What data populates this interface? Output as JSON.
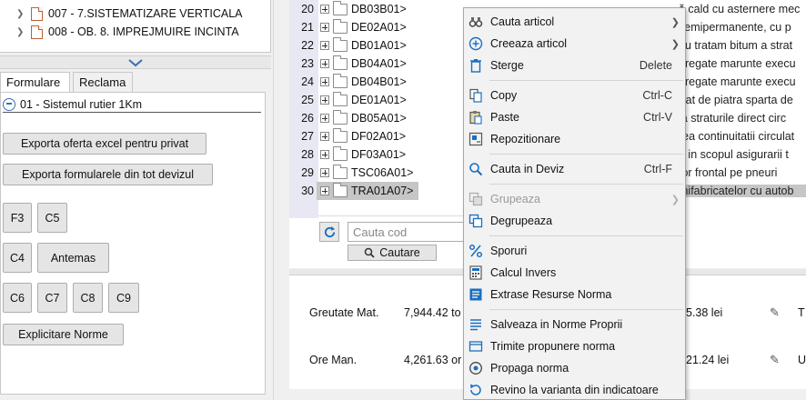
{
  "left_tree": {
    "items": [
      {
        "label": "007 - 7.SISTEMATIZARE VERTICALA"
      },
      {
        "label": "008 - OB. 8. IMPREJMUIRE INCINTA"
      }
    ]
  },
  "left_tabs": [
    {
      "label": "Formulare"
    },
    {
      "label": "Reclama"
    }
  ],
  "form_pane": {
    "title": "01 - Sistemul rutier 1Km",
    "buttons": {
      "export_excel": "Exporta oferta excel pentru privat",
      "export_forms": "Exporta formularele din tot devizul",
      "f3": "F3",
      "c5": "C5",
      "c4": "C4",
      "antemas": "Antemas",
      "c6": "C6",
      "c7": "C7",
      "c8": "C8",
      "c9": "C9",
      "explicitare": "Explicitare Norme"
    }
  },
  "grid": {
    "rows": [
      {
        "num": "20",
        "code": "DB03B01>",
        "desc": "ă cald cu asternere mec"
      },
      {
        "num": "21",
        "code": "DE02A01>",
        "desc": "semipermanente, cu p"
      },
      {
        "num": "22",
        "code": "DB01A01>",
        "desc": "au tratam bitum a strat"
      },
      {
        "num": "23",
        "code": "DB04A01>",
        "desc": "gregate marunte execu"
      },
      {
        "num": "24",
        "code": "DB04B01>",
        "desc": "gregate marunte execu"
      },
      {
        "num": "25",
        "code": "DE01A01>",
        "desc": "trat de piatra sparta de"
      },
      {
        "num": "26",
        "code": "DB05A01>",
        "desc": "la straturile direct circ"
      },
      {
        "num": "27",
        "code": "DF02A01>",
        "desc": "rea continuitatii circulat"
      },
      {
        "num": "28",
        "code": "DF03A01>",
        "desc": "e in scopul asigurarii t"
      },
      {
        "num": "29",
        "code": "TSC06A01>",
        "desc": "tor frontal pe pneuri"
      },
      {
        "num": "30",
        "code": "TRA01A07>",
        "desc": "mifabricatelor cu autob",
        "selected": true
      }
    ]
  },
  "search": {
    "placeholder": "Cauta cod",
    "button_label": "Cautare"
  },
  "bottom": {
    "rows": [
      {
        "label": "Greutate Mat.",
        "value": "7,944.42 to",
        "lei": "5.38 lei",
        "trail": "T"
      },
      {
        "label": "Ore Man.",
        "value": "4,261.63 or",
        "lei": "21.24 lei",
        "trail": "U"
      }
    ]
  },
  "context_menu": {
    "items": [
      {
        "label": "Cauta articol",
        "submenu": true,
        "icon": "binoculars-icon"
      },
      {
        "label": "Creeaza articol",
        "submenu": true,
        "icon": "plus-circle-icon"
      },
      {
        "label": "Sterge",
        "shortcut": "Delete",
        "icon": "trash-icon"
      },
      {
        "label": "Copy",
        "shortcut": "Ctrl-C",
        "icon": "copy-icon"
      },
      {
        "label": "Paste",
        "shortcut": "Ctrl-V",
        "icon": "paste-icon"
      },
      {
        "label": "Repozitionare",
        "icon": "reposition-icon"
      },
      {
        "label": "Cauta in Deviz",
        "shortcut": "Ctrl-F",
        "icon": "search-icon"
      },
      {
        "label": "Grupeaza",
        "submenu": true,
        "disabled": true,
        "icon": "group-icon"
      },
      {
        "label": "Degrupeaza",
        "icon": "ungroup-icon"
      },
      {
        "label": "Sporuri",
        "icon": "percent-icon"
      },
      {
        "label": "Calcul Invers",
        "icon": "calculator-icon"
      },
      {
        "label": "Extrase Resurse Norma",
        "icon": "extract-icon"
      },
      {
        "label": "Salveaza in Norme Proprii",
        "icon": "save-list-icon"
      },
      {
        "label": "Trimite propunere norma",
        "icon": "send-icon"
      },
      {
        "label": "Propaga norma",
        "icon": "propagate-icon"
      },
      {
        "label": "Revino la varianta din indicatoare",
        "icon": "revert-icon"
      }
    ]
  },
  "colors": {
    "accent": "#1a6fc0",
    "selection": "#c6c6c6",
    "gutter": "#e8e8f4"
  }
}
